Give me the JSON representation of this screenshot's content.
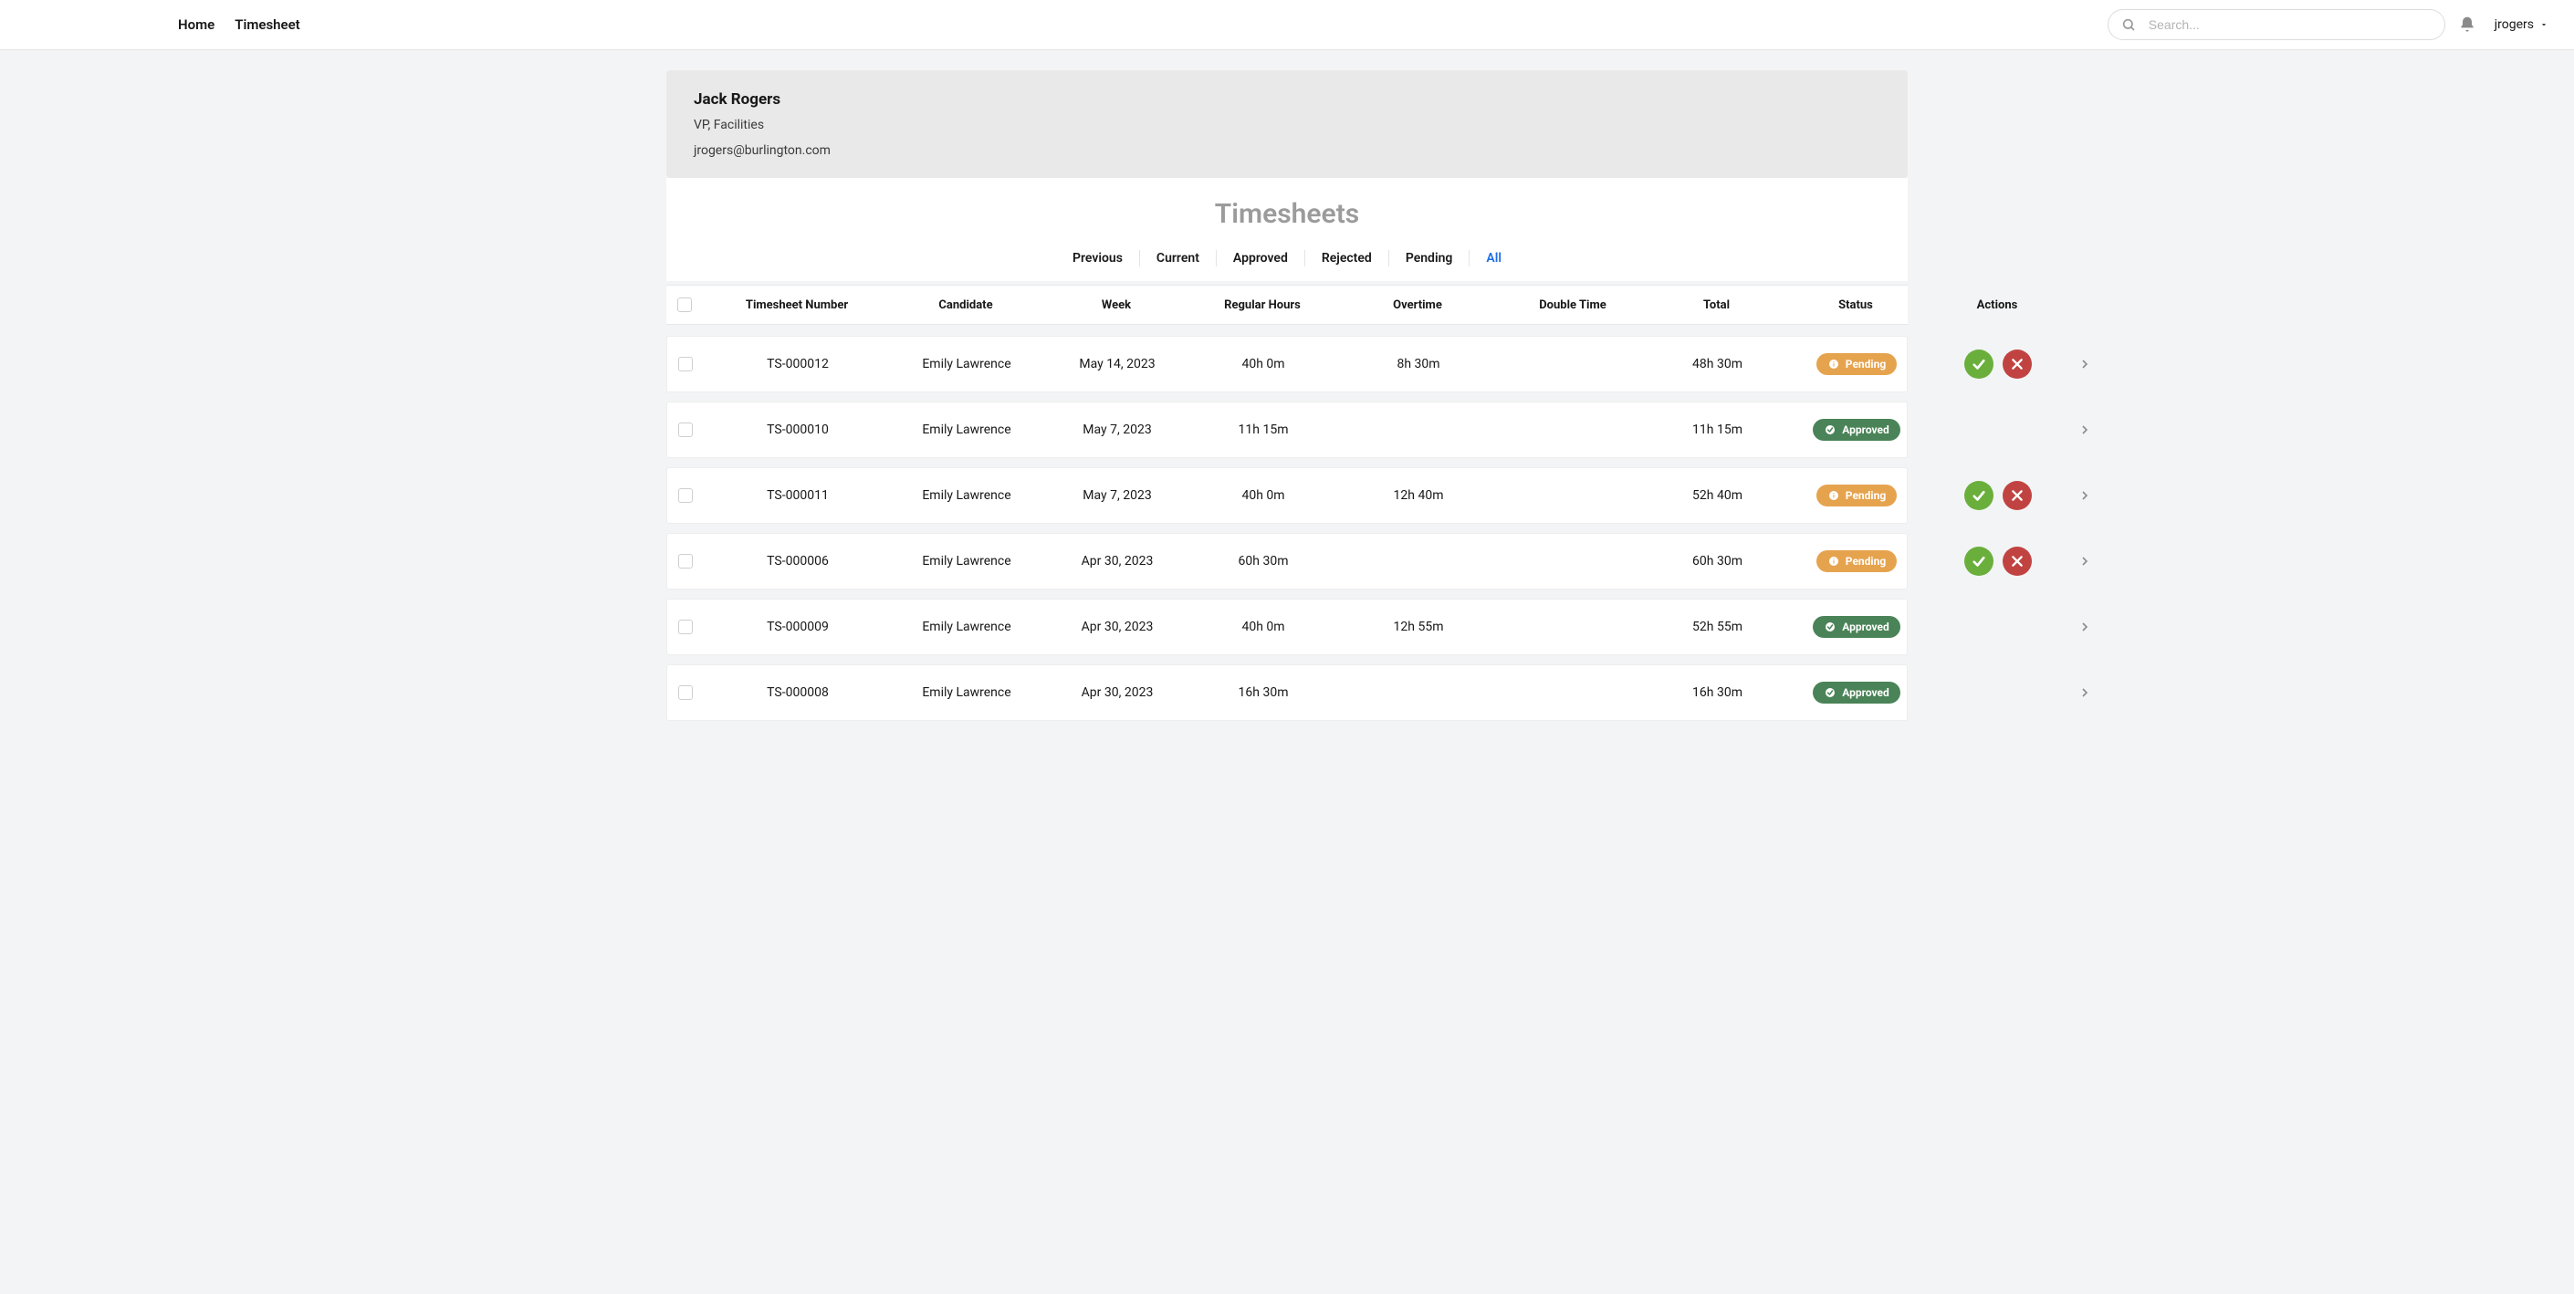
{
  "nav": {
    "home": "Home",
    "timesheet": "Timesheet"
  },
  "search": {
    "placeholder": "Search..."
  },
  "user": {
    "label": "jrogers"
  },
  "profile": {
    "name": "Jack Rogers",
    "title": "VP, Facilities",
    "email": "jrogers@burlington.com"
  },
  "section": {
    "heading": "Timesheets",
    "tabs": {
      "previous": "Previous",
      "current": "Current",
      "approved": "Approved",
      "rejected": "Rejected",
      "pending": "Pending",
      "all": "All"
    },
    "active_tab": "All"
  },
  "headers": {
    "number": "Timesheet Number",
    "candidate": "Candidate",
    "week": "Week",
    "regular": "Regular Hours",
    "overtime": "Overtime",
    "double": "Double Time",
    "total": "Total",
    "status": "Status",
    "actions": "Actions"
  },
  "status_labels": {
    "pending": "Pending",
    "approved": "Approved"
  },
  "rows": [
    {
      "number": "TS-000012",
      "candidate": "Emily Lawrence",
      "week": "May 14, 2023",
      "regular": "40h 0m",
      "overtime": "8h 30m",
      "double": "",
      "total": "48h 30m",
      "status": "pending"
    },
    {
      "number": "TS-000010",
      "candidate": "Emily Lawrence",
      "week": "May 7, 2023",
      "regular": "11h 15m",
      "overtime": "",
      "double": "",
      "total": "11h 15m",
      "status": "approved"
    },
    {
      "number": "TS-000011",
      "candidate": "Emily Lawrence",
      "week": "May 7, 2023",
      "regular": "40h 0m",
      "overtime": "12h 40m",
      "double": "",
      "total": "52h 40m",
      "status": "pending"
    },
    {
      "number": "TS-000006",
      "candidate": "Emily Lawrence",
      "week": "Apr 30, 2023",
      "regular": "60h 30m",
      "overtime": "",
      "double": "",
      "total": "60h 30m",
      "status": "pending"
    },
    {
      "number": "TS-000009",
      "candidate": "Emily Lawrence",
      "week": "Apr 30, 2023",
      "regular": "40h 0m",
      "overtime": "12h 55m",
      "double": "",
      "total": "52h 55m",
      "status": "approved"
    },
    {
      "number": "TS-000008",
      "candidate": "Emily Lawrence",
      "week": "Apr 30, 2023",
      "regular": "16h 30m",
      "overtime": "",
      "double": "",
      "total": "16h 30m",
      "status": "approved"
    }
  ]
}
